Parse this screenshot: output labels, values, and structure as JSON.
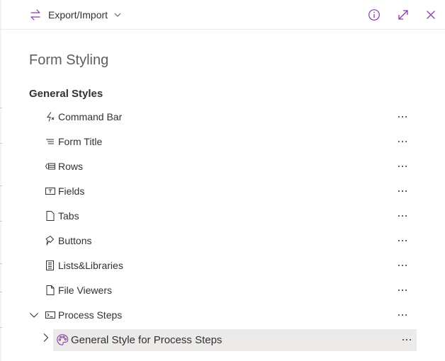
{
  "toolbar": {
    "export_label": "Export/Import",
    "icons": [
      "swap-arrows-icon",
      "chevron-down-icon",
      "info-icon",
      "expand-icon",
      "close-icon"
    ],
    "accent": "#8b3aa8"
  },
  "panel": {
    "title": "Form Styling",
    "section_title": "General Styles",
    "items": [
      {
        "label": "Command Bar",
        "icon": "lightning-command-icon"
      },
      {
        "label": "Form Title",
        "icon": "title-lines-icon"
      },
      {
        "label": "Rows",
        "icon": "rows-icon"
      },
      {
        "label": "Fields",
        "icon": "text-field-icon"
      },
      {
        "label": "Tabs",
        "icon": "tab-page-icon"
      },
      {
        "label": "Buttons",
        "icon": "button-pointer-icon"
      },
      {
        "label": "Lists&Libraries",
        "icon": "list-document-icon"
      },
      {
        "label": "File Viewers",
        "icon": "file-icon"
      },
      {
        "label": "Process Steps",
        "icon": "process-steps-icon",
        "expanded": true
      }
    ],
    "sub_item": {
      "label": "General Style for Process Steps",
      "icon": "palette-icon",
      "selected": true
    },
    "more_label": "···"
  }
}
